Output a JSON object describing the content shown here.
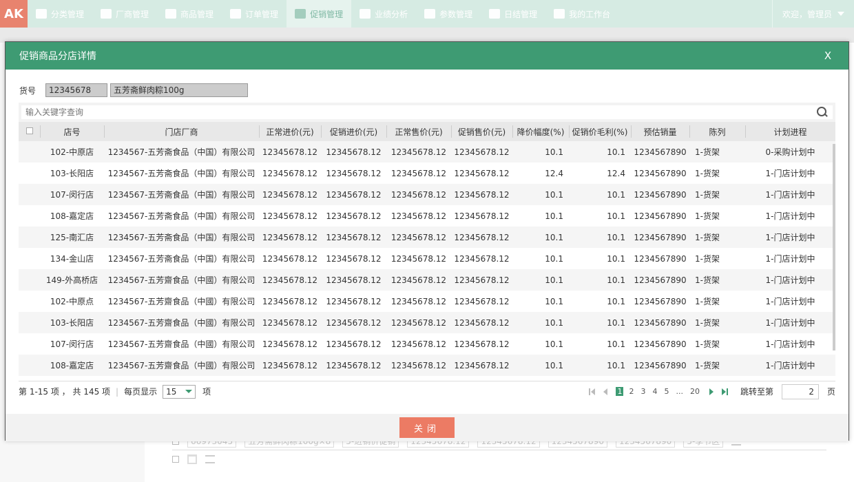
{
  "logo": "AK",
  "nav": {
    "items": [
      {
        "label": "分类管理",
        "icon": "list-icon"
      },
      {
        "label": "厂商管理",
        "icon": "truck-icon"
      },
      {
        "label": "商品管理",
        "icon": "gift-icon"
      },
      {
        "label": "订单管理",
        "icon": "orders-icon"
      },
      {
        "label": "促销管理",
        "icon": "tag-icon",
        "active": true
      },
      {
        "label": "业绩分析",
        "icon": "chart-icon"
      },
      {
        "label": "参数管理",
        "icon": "database-icon"
      },
      {
        "label": "日结管理",
        "icon": "calendar-icon"
      },
      {
        "label": "我的工作台",
        "icon": "briefcase-icon"
      }
    ],
    "user_greeting": "欢迎，管理员"
  },
  "background": {
    "row1": {
      "code": "66973045",
      "name": "五芳斋鲜肉粽100g×8",
      "status": "5-进销价促销",
      "v1": "12345678.12",
      "v2": "12345678.12",
      "v3": "1234567890",
      "v4": "1234567890",
      "v5": "5-季节区"
    }
  },
  "dialog": {
    "title": "促销商品分店详情",
    "close_x": "X",
    "item_label": "货号",
    "item_code": "12345678",
    "item_name": "五芳斋鲜肉粽100g",
    "search_placeholder": "输入关键字查询",
    "columns": [
      "店号",
      "门店厂商",
      "正常进价(元)",
      "促销进价(元)",
      "正常售价(元)",
      "促销售价(元)",
      "降价幅度(%)",
      "促销价毛利(%)",
      "预估销量",
      "陈列",
      "计划进程"
    ],
    "rows": [
      {
        "store": "102-中原店",
        "vendor": "1234567-五芳斋食品（中国）有限公司",
        "np": "12345678.12",
        "pp": "12345678.12",
        "ns": "12345678.12",
        "ps": "12345678.12",
        "drop": "10.1",
        "margin": "10.1",
        "sales": "1234567890",
        "display": "1-货架",
        "plan": "0-采购计划中"
      },
      {
        "store": "103-长阳店",
        "vendor": "1234567-五芳斋食品（中国）有限公司",
        "np": "12345678.12",
        "pp": "12345678.12",
        "ns": "12345678.12",
        "ps": "12345678.12",
        "drop": "12.4",
        "margin": "12.4",
        "sales": "1234567890",
        "display": "1-货架",
        "plan": "1-门店计划中"
      },
      {
        "store": "107-闵行店",
        "vendor": "1234567-五芳斋食品（中国）有限公司",
        "np": "12345678.12",
        "pp": "12345678.12",
        "ns": "12345678.12",
        "ps": "12345678.12",
        "drop": "10.1",
        "margin": "10.1",
        "sales": "1234567890",
        "display": "1-货架",
        "plan": "1-门店计划中"
      },
      {
        "store": "108-嘉定店",
        "vendor": "1234567-五芳斋食品（中国）有限公司",
        "np": "12345678.12",
        "pp": "12345678.12",
        "ns": "12345678.12",
        "ps": "12345678.12",
        "drop": "10.1",
        "margin": "10.1",
        "sales": "1234567890",
        "display": "1-货架",
        "plan": "1-门店计划中"
      },
      {
        "store": "125-南汇店",
        "vendor": "1234567-五芳斋食品（中国）有限公司",
        "np": "12345678.12",
        "pp": "12345678.12",
        "ns": "12345678.12",
        "ps": "12345678.12",
        "drop": "10.1",
        "margin": "10.1",
        "sales": "1234567890",
        "display": "1-货架",
        "plan": "1-门店计划中"
      },
      {
        "store": "134-金山店",
        "vendor": "1234567-五芳斋食品（中国）有限公司",
        "np": "12345678.12",
        "pp": "12345678.12",
        "ns": "12345678.12",
        "ps": "12345678.12",
        "drop": "10.1",
        "margin": "10.1",
        "sales": "1234567890",
        "display": "1-货架",
        "plan": "1-门店计划中"
      },
      {
        "store": "149-外高桥店",
        "vendor": "1234567-五芳齋食品（中國）有限公司",
        "np": "12345678.12",
        "pp": "12345678.12",
        "ns": "12345678.12",
        "ps": "12345678.12",
        "drop": "10.1",
        "margin": "10.1",
        "sales": "1234567890",
        "display": "1-货架",
        "plan": "1-门店计划中"
      },
      {
        "store": "102-中原点",
        "vendor": "1234567-五芳齋食品（中國）有限公司",
        "np": "12345678.12",
        "pp": "12345678.12",
        "ns": "12345678.12",
        "ps": "12345678.12",
        "drop": "10.1",
        "margin": "10.1",
        "sales": "1234567890",
        "display": "1-货架",
        "plan": "1-门店计划中"
      },
      {
        "store": "103-长阳店",
        "vendor": "1234567-五芳齋食品（中國）有限公司",
        "np": "12345678.12",
        "pp": "12345678.12",
        "ns": "12345678.12",
        "ps": "12345678.12",
        "drop": "10.1",
        "margin": "10.1",
        "sales": "1234567890",
        "display": "1-货架",
        "plan": "1-门店计划中"
      },
      {
        "store": "107-闵行店",
        "vendor": "1234567-五芳齋食品（中國）有限公司",
        "np": "12345678.12",
        "pp": "12345678.12",
        "ns": "12345678.12",
        "ps": "12345678.12",
        "drop": "10.1",
        "margin": "10.1",
        "sales": "1234567890",
        "display": "1-货架",
        "plan": "1-门店计划中"
      },
      {
        "store": "108-嘉定店",
        "vendor": "1234567-五芳齋食品（中國）有限公司",
        "np": "12345678.12",
        "pp": "12345678.12",
        "ns": "12345678.12",
        "ps": "12345678.12",
        "drop": "10.1",
        "margin": "10.1",
        "sales": "1234567890",
        "display": "1-货架",
        "plan": "1-门店计划中"
      }
    ],
    "pager": {
      "summary": "第 1-15 项 ， 共 145 项",
      "per_page_label": "每页显示",
      "per_page_value": "15",
      "unit": "项",
      "pages": [
        "1",
        "2",
        "3",
        "4",
        "5",
        "...",
        "20"
      ],
      "jump_label": "跳转至第",
      "jump_value": "2",
      "jump_unit": "页"
    },
    "close_button": "关闭"
  }
}
